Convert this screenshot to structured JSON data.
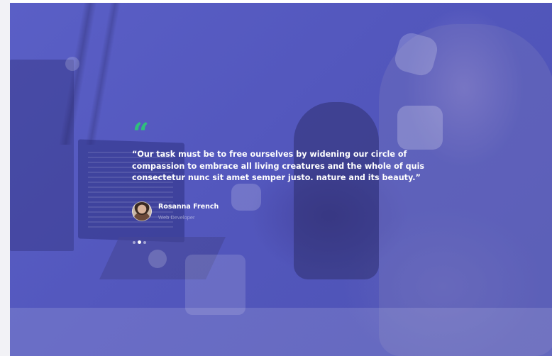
{
  "testimonial": {
    "quote_mark": "66",
    "quote": "“Our task must be to free ourselves by widening our circle of compassion to embrace all living creatures and the whole of quis consectetur nunc sit amet semper justo. nature and its beauty.”",
    "author_name": "Rosanna French",
    "author_role": "Web Developer"
  },
  "slider": {
    "slide_count": 3,
    "active_index": 1
  },
  "colors": {
    "overlay": "#5357bd",
    "quote_mark": "#2fbf7c",
    "text": "#ffffff"
  }
}
